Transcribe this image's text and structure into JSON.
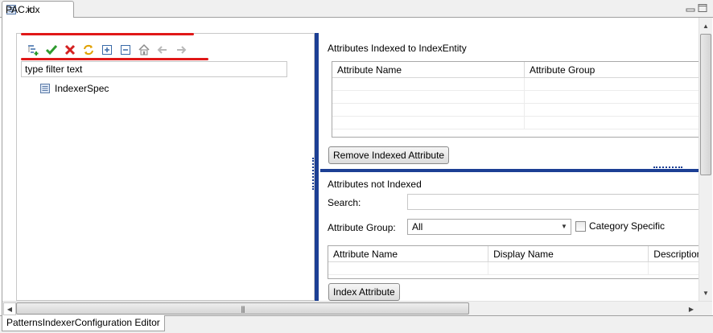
{
  "editor_tab": {
    "title": "PAC.idx",
    "close_icon": "close-icon"
  },
  "window": {
    "minimize_icon": "minimize-icon",
    "maximize_icon": "maximize-icon"
  },
  "left": {
    "toolbar": [
      {
        "name": "add-child-icon"
      },
      {
        "name": "apply-checkmark-icon"
      },
      {
        "name": "delete-x-icon"
      },
      {
        "name": "refresh-icon"
      },
      {
        "name": "expand-all-icon"
      },
      {
        "name": "collapse-all-icon"
      },
      {
        "name": "home-icon"
      },
      {
        "name": "back-arrow-icon"
      },
      {
        "name": "forward-arrow-icon"
      }
    ],
    "filter_text": "type filter text",
    "tree_item": "IndexerSpec"
  },
  "indexed": {
    "title": "Attributes Indexed to IndexEntity",
    "columns": [
      "Attribute Name",
      "Attribute Group"
    ],
    "remove_button": "Remove Indexed Attribute"
  },
  "not_indexed": {
    "title": "Attributes not Indexed",
    "search_label": "Search:",
    "search_value": "",
    "group_label": "Attribute Group:",
    "group_value": "All",
    "category_specific": "Category Specific",
    "columns": [
      "Attribute Name",
      "Display Name",
      "Description"
    ],
    "index_button": "Index Attribute"
  },
  "bottom_tab": "PatternsIndexerConfiguration Editor",
  "colors": {
    "accent": "#1c3f94",
    "highlight": "#e01818"
  }
}
